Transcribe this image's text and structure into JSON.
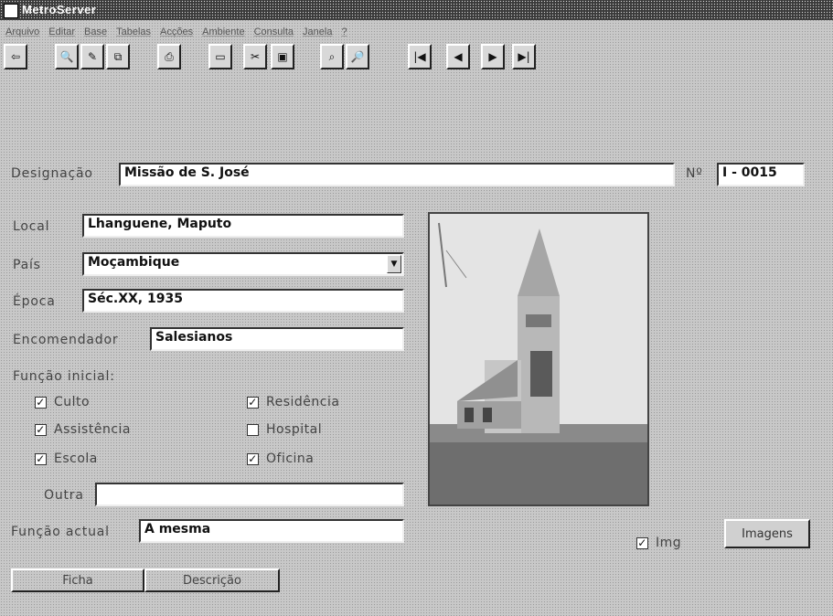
{
  "window": {
    "title": "MetroServer"
  },
  "menu": [
    "Arquivo",
    "Editar",
    "Base",
    "Tabelas",
    "Acções",
    "Ambiente",
    "Consulta",
    "Janela",
    "?"
  ],
  "toolbar": {
    "buttons": [
      {
        "name": "exit-icon",
        "glyph": "⇦"
      },
      {
        "name": "preview-icon",
        "glyph": "🔍"
      },
      {
        "name": "edit-icon",
        "glyph": "✎"
      },
      {
        "name": "copy-icon",
        "glyph": "⧉"
      },
      {
        "name": "print-icon",
        "glyph": "⎙"
      },
      {
        "name": "new-record-icon",
        "glyph": "▭"
      },
      {
        "name": "cut-icon",
        "glyph": "✂"
      },
      {
        "name": "save-icon",
        "glyph": "▣"
      },
      {
        "name": "find-icon",
        "glyph": "⌕"
      },
      {
        "name": "zoom-icon",
        "glyph": "🔎"
      },
      {
        "name": "first-record-icon",
        "glyph": "|◀"
      },
      {
        "name": "previous-record-icon",
        "glyph": "◀"
      },
      {
        "name": "next-record-icon",
        "glyph": "▶"
      },
      {
        "name": "last-record-icon",
        "glyph": "▶|"
      }
    ]
  },
  "form": {
    "designacao_label": "Designação",
    "designacao_value": "Missão de S. José",
    "numero_label": "Nº",
    "numero_value": "I - 0015",
    "local_label": "Local",
    "local_value": "Lhanguene, Maputo",
    "pais_label": "País",
    "pais_value": "Moçambique",
    "epoca_label": "Época",
    "epoca_value": "Séc.XX, 1935",
    "encomendador_label": "Encomendador",
    "encomendador_value": "Salesianos",
    "funcao_inicial_label": "Função inicial:",
    "checkboxes": [
      {
        "label": "Culto",
        "checked": true
      },
      {
        "label": "Residência",
        "checked": true
      },
      {
        "label": "Assistência",
        "checked": true
      },
      {
        "label": "Hospital",
        "checked": false
      },
      {
        "label": "Escola",
        "checked": true
      },
      {
        "label": "Oficina",
        "checked": true
      }
    ],
    "outra_label": "Outra",
    "outra_value": "",
    "funcao_actual_label": "Função actual",
    "funcao_actual_value": "A mesma",
    "img_label": "Img",
    "img_checked": true,
    "imagens_button": "Imagens"
  },
  "tabs": {
    "ficha": "Ficha",
    "descricao": "Descrição"
  }
}
